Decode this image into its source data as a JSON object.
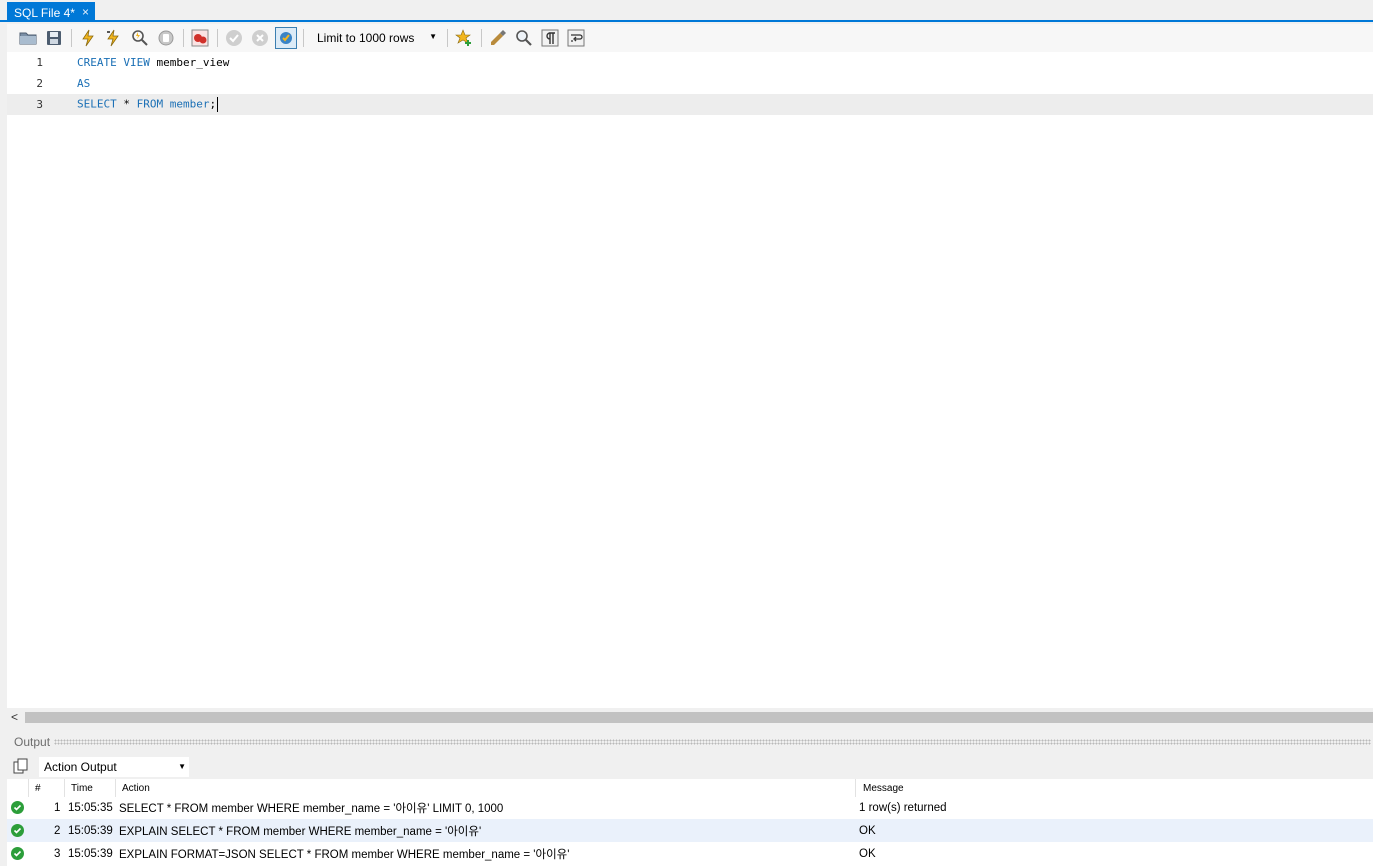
{
  "tab": {
    "title": "SQL File 4*",
    "close_glyph": "×"
  },
  "toolbar": {
    "limit_label": "Limit to 1000 rows",
    "icons": [
      "open-folder-icon",
      "save-icon",
      "execute-icon",
      "execute-current-icon",
      "explain-icon",
      "stop-icon",
      "stop-on-error-icon",
      "commit-icon",
      "rollback-icon",
      "autocommit-icon",
      "limit-dropdown",
      "add-snippet-icon",
      "beautify-icon",
      "find-icon",
      "invisible-chars-icon",
      "wrap-lines-icon"
    ]
  },
  "editor": {
    "lines": [
      {
        "no": "1",
        "tokens": [
          {
            "t": "CREATE VIEW",
            "kw": true
          },
          {
            "t": " member_view",
            "kw": false
          }
        ]
      },
      {
        "no": "2",
        "tokens": [
          {
            "t": "AS",
            "kw": true
          }
        ]
      },
      {
        "no": "3",
        "tokens": [
          {
            "t": "SELECT",
            "kw": true
          },
          {
            "t": " * ",
            "kw": false
          },
          {
            "t": "FROM",
            "kw": true
          },
          {
            "t": " member",
            "kw": true
          },
          {
            "t": ";",
            "kw": false
          }
        ]
      }
    ],
    "keyword_color": "#1a6fb5"
  },
  "output": {
    "panel_label": "Output",
    "selector_value": "Action Output",
    "columns": {
      "num": "#",
      "time": "Time",
      "action": "Action",
      "message": "Message"
    },
    "rows": [
      {
        "num": "1",
        "time": "15:05:35",
        "action": "SELECT * FROM member WHERE member_name = '아이유' LIMIT 0, 1000",
        "message": "1 row(s) returned",
        "status": "ok"
      },
      {
        "num": "2",
        "time": "15:05:39",
        "action": "EXPLAIN SELECT * FROM member WHERE member_name = '아이유'",
        "message": "OK",
        "status": "ok"
      },
      {
        "num": "3",
        "time": "15:05:39",
        "action": "EXPLAIN FORMAT=JSON SELECT * FROM member WHERE member_name = '아이유'",
        "message": "OK",
        "status": "ok"
      }
    ]
  },
  "colors": {
    "accent": "#0078d7",
    "ok": "#2c9e3a",
    "row_highlight": "#eaf1fb"
  }
}
